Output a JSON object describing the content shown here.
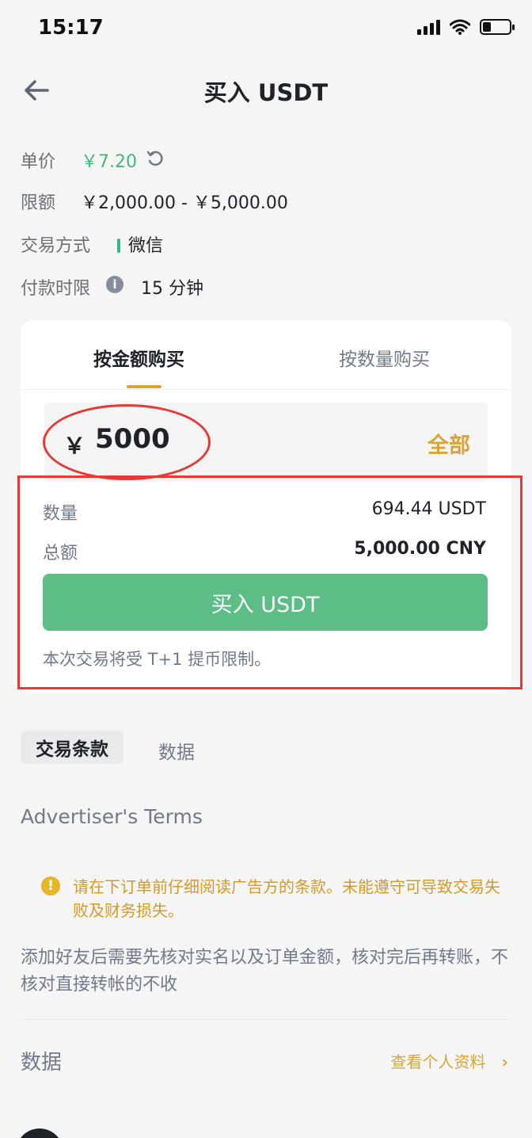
{
  "status_bar": {
    "time": "15:17"
  },
  "header": {
    "title": "买入 USDT"
  },
  "info": {
    "price_label": "单价",
    "price_value": "￥7.20",
    "limit_label": "限额",
    "limit_value": "￥2,000.00 - ￥5,000.00",
    "payment_label": "交易方式",
    "payment_value": "微信",
    "time_limit_label": "付款时限",
    "time_limit_value": "15 分钟"
  },
  "tabs": [
    {
      "label": "按金额购买",
      "active": true
    },
    {
      "label": "按数量购买",
      "active": false
    }
  ],
  "amount": {
    "currency_symbol": "￥",
    "value": "5000",
    "all_label": "全部"
  },
  "summary": {
    "quantity_label": "数量",
    "quantity_value": "694.44 USDT",
    "total_label": "总额",
    "total_value": "5,000.00 CNY"
  },
  "buy_button_label": "买入 USDT",
  "notice": "本次交易将受 T+1 提币限制。",
  "section_tabs": [
    {
      "label": "交易条款",
      "active": true
    },
    {
      "label": "数据",
      "active": false
    }
  ],
  "terms": {
    "title": "Advertiser's Terms",
    "warning": "请在下订单前仔细阅读广告方的条款。未能遵守可导致交易失败及财务损失。",
    "body": "添加好友后需要先核对实名以及订单金额，核对完后再转账，不核对直接转帐的不收"
  },
  "data_section": {
    "title": "数据",
    "link_label": "查看个人资料"
  },
  "colors": {
    "accent": "#d6a536",
    "buy_green": "#5cbd86",
    "price_green": "#3dbb7a",
    "annotation_red": "#e53935"
  }
}
